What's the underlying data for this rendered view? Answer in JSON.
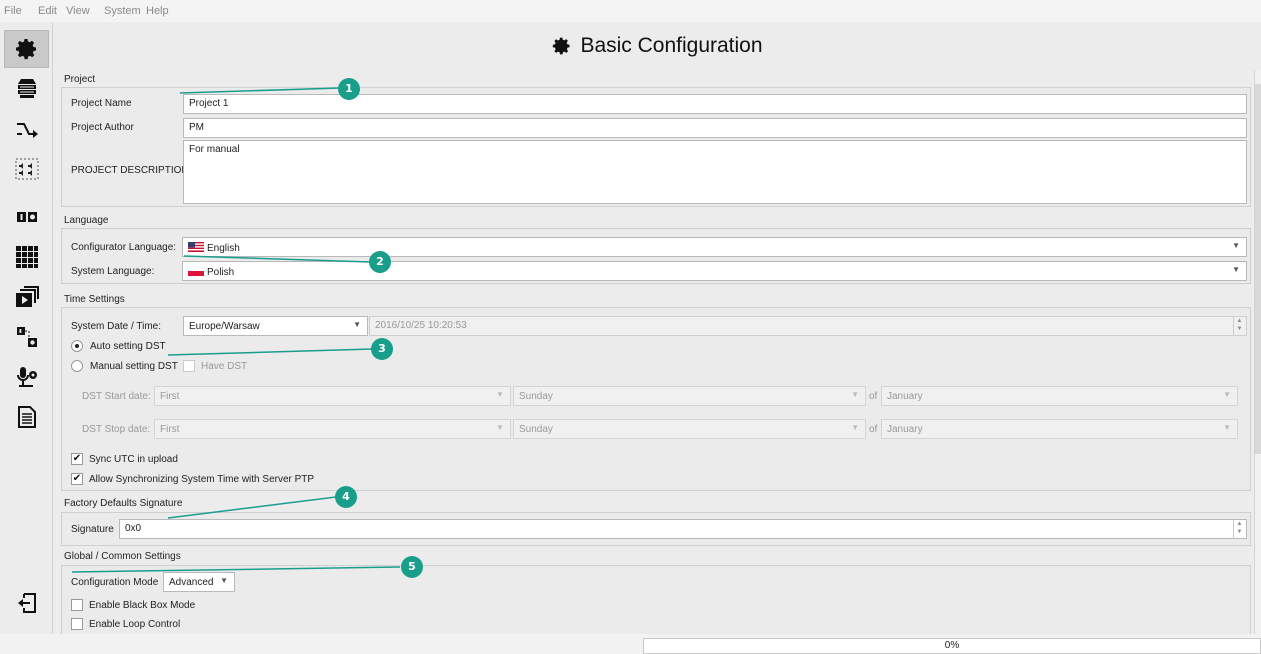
{
  "menu": [
    "File",
    "Edit",
    "View",
    "System",
    "Help"
  ],
  "sidebar": {
    "items": [
      {
        "icon": "gear-icon",
        "active": true
      },
      {
        "icon": "server-rack-icon"
      },
      {
        "icon": "routing-icon"
      },
      {
        "icon": "speaker-zones-icon"
      },
      {
        "icon": "io-icon"
      },
      {
        "icon": "grid-icon"
      },
      {
        "icon": "media-stack-icon"
      },
      {
        "icon": "device-link-icon"
      },
      {
        "icon": "microphone-settings-icon"
      },
      {
        "icon": "document-icon"
      },
      {
        "icon": "exit-icon"
      }
    ]
  },
  "header": {
    "title": "Basic Configuration",
    "icon": "gear-icon"
  },
  "project": {
    "group_title": "Project",
    "name_label": "Project Name",
    "name_value": "Project 1",
    "author_label": "Project Author",
    "author_value": "PM",
    "description_label": "PROJECT DESCRIPTION",
    "description_value": "For manual"
  },
  "language": {
    "group_title": "Language",
    "configurator_label": "Configurator Language:",
    "configurator_value": "English",
    "system_label": "System Language:",
    "system_value": "Polish"
  },
  "time": {
    "group_title": "Time Settings",
    "date_label": "System Date / Time:",
    "timezone_value": "Europe/Warsaw",
    "datetime_value": "2016/10/25 10:20:53",
    "auto_dst_label": "Auto setting DST",
    "manual_dst_label": "Manual setting DST",
    "have_dst_label": "Have DST",
    "dst_start_label": "DST Start date:",
    "dst_stop_label": "DST Stop date:",
    "week_value": "First",
    "day_value": "Sunday",
    "of_label": "of",
    "month_value": "January",
    "sync_utc_label": "Sync UTC in upload",
    "sync_ptp_label": "Allow Synchronizing System Time with Server PTP"
  },
  "factory": {
    "group_title": "Factory Defaults Signature",
    "signature_label": "Signature",
    "signature_value": "0x0"
  },
  "global": {
    "group_title": "Global / Common Settings",
    "mode_label": "Configuration Mode",
    "mode_value": "Advanced",
    "black_box_label": "Enable Black Box Mode",
    "loop_label": "Enable Loop Control"
  },
  "callouts": [
    "1",
    "2",
    "3",
    "4",
    "5"
  ],
  "progress": {
    "value": 0,
    "label": "0%"
  },
  "colors": {
    "callout": "#1a9e8c",
    "flag_us_red": "#c8102e",
    "flag_us_blue": "#3c3b6e",
    "flag_pl_red": "#dc143c"
  }
}
